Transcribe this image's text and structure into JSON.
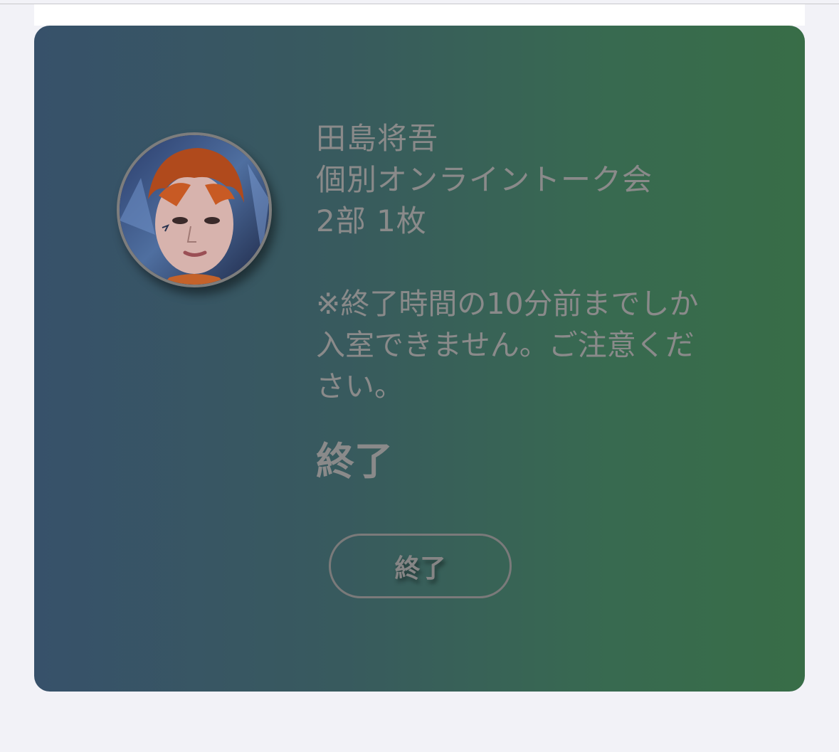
{
  "event": {
    "artist_name": "田島将吾",
    "event_title": "個別オンライントーク会",
    "session_info": "2部 1枚",
    "notice": "※終了時間の10分前までしか入室できません。ご注意ください。",
    "status": "終了"
  },
  "actions": {
    "end_button_label": "終了"
  },
  "colors": {
    "card_gradient_start": "#37516a",
    "card_gradient_end": "#386d47",
    "text_muted": "#8a8a8a",
    "page_background": "#f2f2f7"
  },
  "icons": {
    "avatar": "artist-avatar-photo"
  }
}
